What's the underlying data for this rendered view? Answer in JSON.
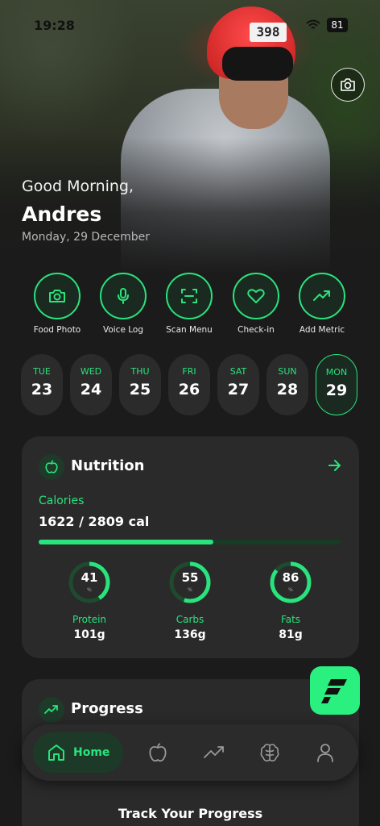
{
  "status_bar": {
    "time": "19:28",
    "battery": "81"
  },
  "hero": {
    "bib_number": "398",
    "greeting": "Good Morning,",
    "user_name": "Andres",
    "date": "Monday, 29 December"
  },
  "quick_actions": [
    {
      "label": "Food Photo",
      "icon": "camera-icon"
    },
    {
      "label": "Voice Log",
      "icon": "microphone-icon"
    },
    {
      "label": "Scan Menu",
      "icon": "scan-icon"
    },
    {
      "label": "Check-in",
      "icon": "heart-icon"
    },
    {
      "label": "Add Metric",
      "icon": "trending-up-icon"
    }
  ],
  "days": [
    {
      "dow": "TUE",
      "num": "23"
    },
    {
      "dow": "WED",
      "num": "24"
    },
    {
      "dow": "THU",
      "num": "25"
    },
    {
      "dow": "FRI",
      "num": "26"
    },
    {
      "dow": "SAT",
      "num": "27"
    },
    {
      "dow": "SUN",
      "num": "28"
    },
    {
      "dow": "MON",
      "num": "29",
      "selected": true
    }
  ],
  "nutrition": {
    "title": "Nutrition",
    "calories_label": "Calories",
    "calories_value": "1622 / 2809 cal",
    "calories_fraction": 0.577,
    "macros": [
      {
        "name": "Protein",
        "percent": "41",
        "amount": "101g",
        "percent_sign": "%"
      },
      {
        "name": "Carbs",
        "percent": "55",
        "amount": "136g",
        "percent_sign": "%"
      },
      {
        "name": "Fats",
        "percent": "86",
        "amount": "81g",
        "percent_sign": "%"
      }
    ]
  },
  "progress": {
    "title": "Progress",
    "track_title": "Track Your Progress"
  },
  "bottom_nav": {
    "home_label": "Home"
  },
  "colors": {
    "accent": "#29e37c",
    "card": "#2a2a2a",
    "background": "#1b1b1b"
  }
}
